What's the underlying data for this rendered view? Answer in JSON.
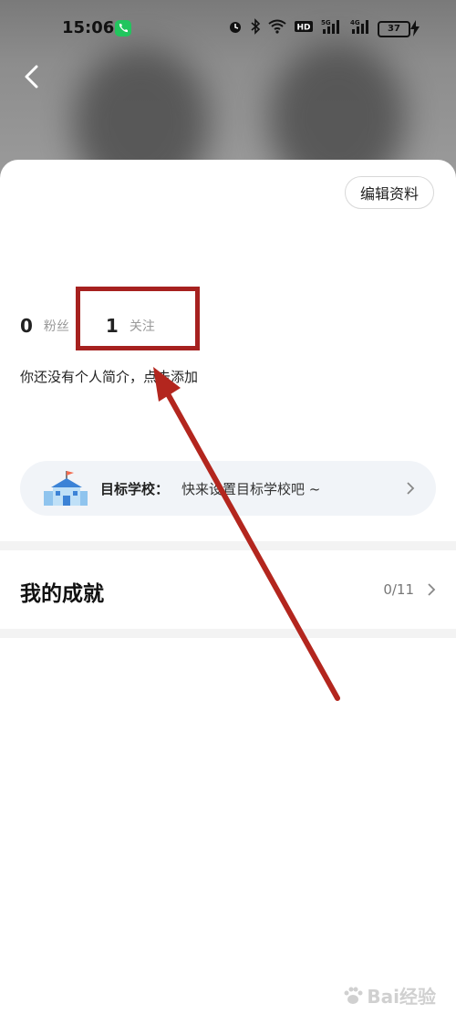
{
  "status_bar": {
    "time": "15:06",
    "battery": "37",
    "icons": [
      "phone-call-icon",
      "alarm-icon",
      "bluetooth-icon",
      "wifi-icon",
      "hd-icon",
      "signal-5g-icon",
      "signal-4g-icon",
      "battery-icon",
      "charging-icon"
    ]
  },
  "header": {
    "back_icon": "chevron-left-icon"
  },
  "profile": {
    "edit_label": "编辑资料",
    "followers_count": "0",
    "followers_label": "粉丝",
    "following_count": "1",
    "following_label": "关注",
    "bio": "你还没有个人简介，点击添加"
  },
  "target_school": {
    "label": "目标学校：",
    "value": "快来设置目标学校吧 ~"
  },
  "achievements": {
    "title": "我的成就",
    "count": "0/11"
  },
  "annotation": {
    "highlight_color": "#a6211f",
    "arrow_color": "#b3261e"
  },
  "watermark": {
    "text": "Bai经验"
  }
}
